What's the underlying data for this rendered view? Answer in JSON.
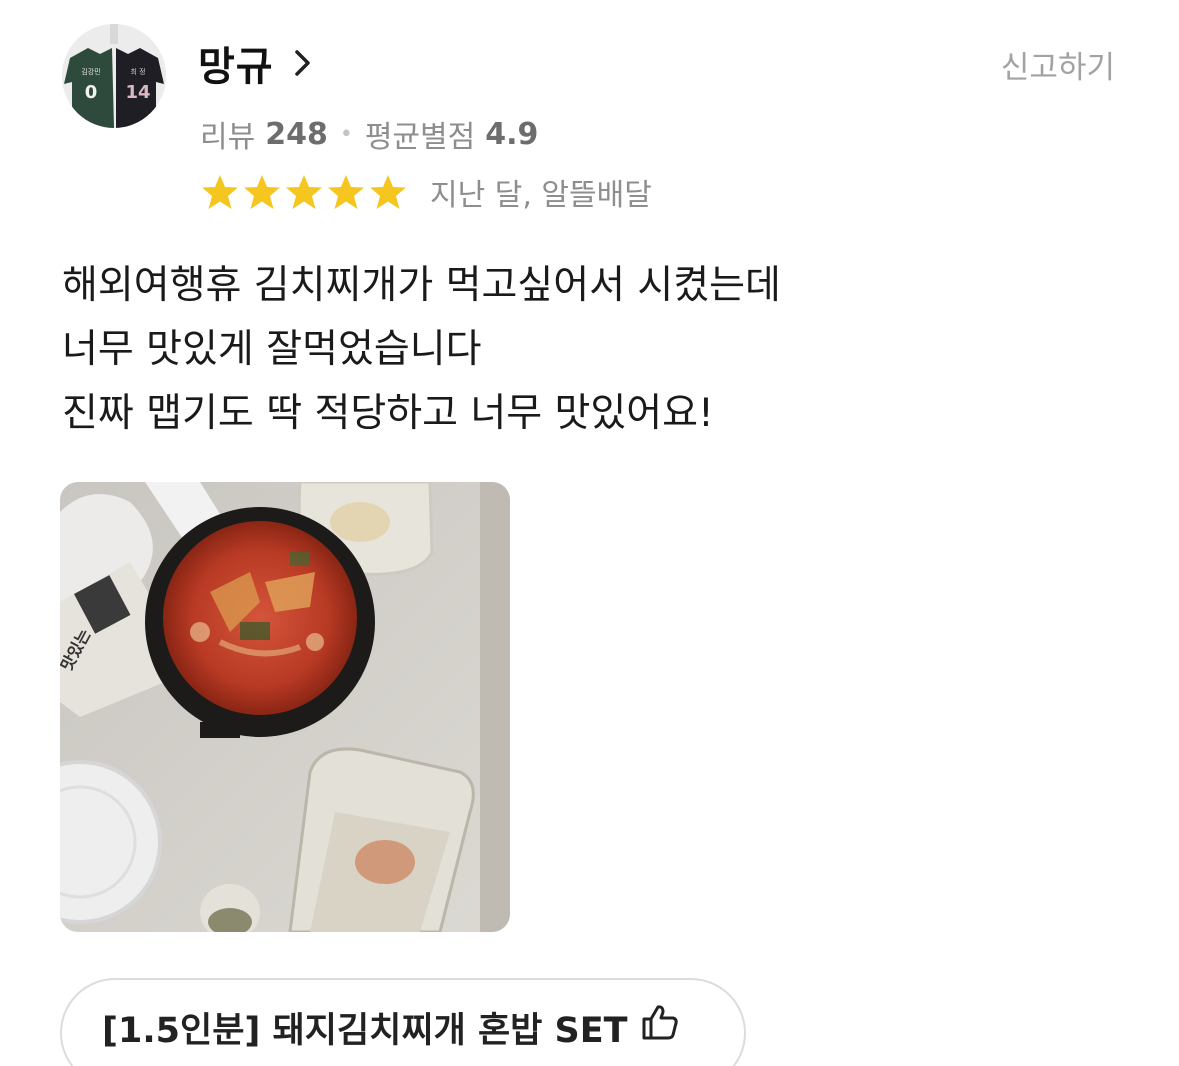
{
  "reviewer": {
    "name": "망규",
    "avatar_jersey_left_text": "김강민",
    "avatar_jersey_left_number": "0",
    "avatar_jersey_right_text": "최 정",
    "avatar_jersey_right_number": "14"
  },
  "report_label": "신고하기",
  "stats": {
    "review_label": "리뷰",
    "review_count": "248",
    "separator": "•",
    "avg_label": "평균별점",
    "avg_rating": "4.9"
  },
  "rating": {
    "stars": 5,
    "star_color": "#f5c61f",
    "meta": "지난 달, 알뜰배달"
  },
  "review_lines": [
    "해외여행휴 김치찌개가 먹고싶어서 시켰는데",
    "너무 맛있게 잘먹었습니다",
    "진짜 맵기도 딱 적당하고 너무 맛있어요!"
  ],
  "photo": {
    "description_icon": "food-photo",
    "seaweed_pack_text": "맛있는"
  },
  "menu_tag": {
    "label": "[1.5인분] 돼지김치찌개 혼밥 SET",
    "icon": "thumbs-up-icon"
  }
}
